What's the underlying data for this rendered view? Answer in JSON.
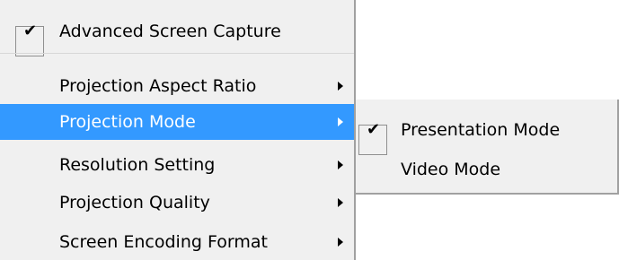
{
  "main_menu": {
    "advanced_capture": {
      "label": "Advanced Screen Capture",
      "checked": true,
      "check_icon": "✔"
    },
    "items": [
      {
        "label": "Projection Aspect Ratio",
        "has_submenu": true,
        "highlighted": false
      },
      {
        "label": "Projection Mode",
        "has_submenu": true,
        "highlighted": true
      },
      {
        "label": "Resolution Setting",
        "has_submenu": true,
        "highlighted": false
      },
      {
        "label": "Projection Quality",
        "has_submenu": true,
        "highlighted": false
      },
      {
        "label": "Screen Encoding Format",
        "has_submenu": true,
        "highlighted": false
      }
    ]
  },
  "submenu": {
    "items": [
      {
        "label": "Presentation Mode",
        "checked": true,
        "check_icon": "✔"
      },
      {
        "label": "Video Mode",
        "checked": false
      }
    ]
  },
  "colors": {
    "menu_background": "#f0f0f0",
    "highlight": "#3399ff",
    "highlight_text": "#ffffff",
    "border": "#a0a0a0"
  }
}
